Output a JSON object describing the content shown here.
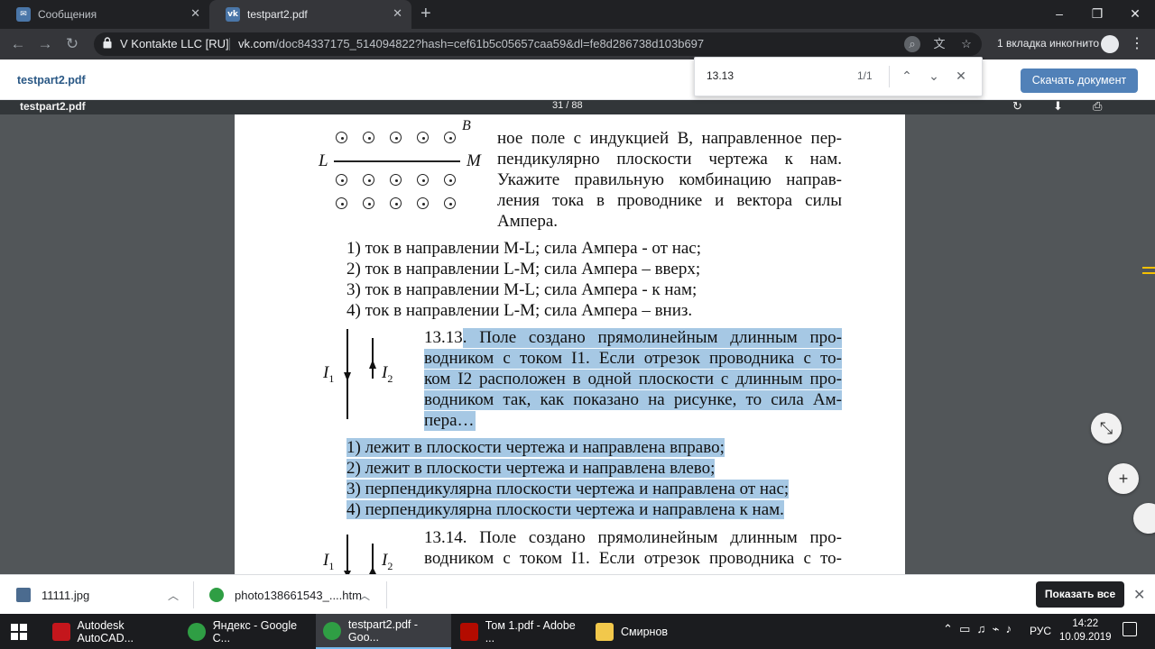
{
  "browser": {
    "tabs": [
      {
        "label": "Сообщения",
        "icon": "vk-message-icon"
      },
      {
        "label": "testpart2.pdf",
        "icon": "vk-icon"
      }
    ],
    "new_tab": "+",
    "window_controls": [
      "–",
      "❐",
      "✕"
    ],
    "nav": {
      "back": "←",
      "forward": "→",
      "reload": "↻"
    },
    "site_name": "V Kontakte LLC [RU]",
    "url_host": "vk.com",
    "url_rest": "/doc84337175_514094822?hash=cef61b5c05657caa59&dl=fe8d286738d103b697",
    "incognito_label": "1 вкладка инкогнито",
    "menu": "⋮"
  },
  "vk": {
    "filename": "testpart2.pdf",
    "download_label": "Скачать документ"
  },
  "find": {
    "query": "13.13",
    "count": "1/1",
    "prev": "⌃",
    "next": "⌄",
    "close": "✕"
  },
  "pdf_viewer": {
    "title": "testpart2.pdf",
    "pages": "31 / 88"
  },
  "document": {
    "fig1": {
      "L": "L",
      "M": "M",
      "B": "B"
    },
    "q_intro_lines": [
      "ное поле с индукцией B, направленное пер-",
      "пендикулярно плоскости чертежа к нам.",
      "Укажите правильную комбинацию направ-",
      "ления тока в проводнике и вектора силы",
      "Ампера."
    ],
    "q12_options": [
      "1) ток в направлении M-L; сила Ампера - от нас;",
      "2)  ток в направлении L-M; сила Ампера – вверх;",
      "3) ток в направлении M-L; сила Ампера - к нам;",
      "4) ток в направлении L-M; сила Ампера – вниз."
    ],
    "q13_number": "13.13",
    "q13_lines": [
      ". Поле создано прямолинейным длинным про-",
      "водником с током I1. Если отрезок проводника с то-",
      "ком I2 расположен в одной плоскости с длинным про-",
      "водником так, как показано на рисунке, то сила Ам-",
      "пера…"
    ],
    "fig2": {
      "I1": "I",
      "I1_sub": "1",
      "I2": "I",
      "I2_sub": "2"
    },
    "q13_options": [
      "1) лежит в плоскости чертежа и направлена вправо;",
      "2) лежит в плоскости чертежа и направлена влево;",
      "3) перпендикулярна плоскости чертежа и направлена от нас;",
      "4) перпендикулярна плоскости чертежа и направлена к нам."
    ],
    "q14_lines": [
      "13.14. Поле создано прямолинейным длинным про-",
      "водником с током I1. Если отрезок проводника с то-"
    ]
  },
  "fab": {
    "fit": "⤡",
    "zoom_in": "+"
  },
  "downloads": [
    {
      "name": "11111.jpg",
      "icon": "jpg-file-icon"
    },
    {
      "name": "photo138661543_....htm",
      "icon": "chrome-icon"
    }
  ],
  "shelf": {
    "show_all": "Показать все",
    "close": "✕"
  },
  "taskbar": {
    "items": [
      {
        "label": "Autodesk AutoCAD...",
        "icon": "autocad-icon",
        "color": "#c4161c"
      },
      {
        "label": "Яндекс - Google C...",
        "icon": "chrome-icon",
        "color": "#2f9e44"
      },
      {
        "label": "testpart2.pdf - Goo...",
        "icon": "chrome-icon",
        "color": "#2f9e44"
      },
      {
        "label": "Том 1.pdf - Adobe ...",
        "icon": "adobe-reader-icon",
        "color": "#b30b00"
      },
      {
        "label": "Смирнов",
        "icon": "folder-icon",
        "color": "#f2c84b"
      }
    ],
    "language": "РУС",
    "time": "14:22",
    "date": "10.09.2019"
  }
}
